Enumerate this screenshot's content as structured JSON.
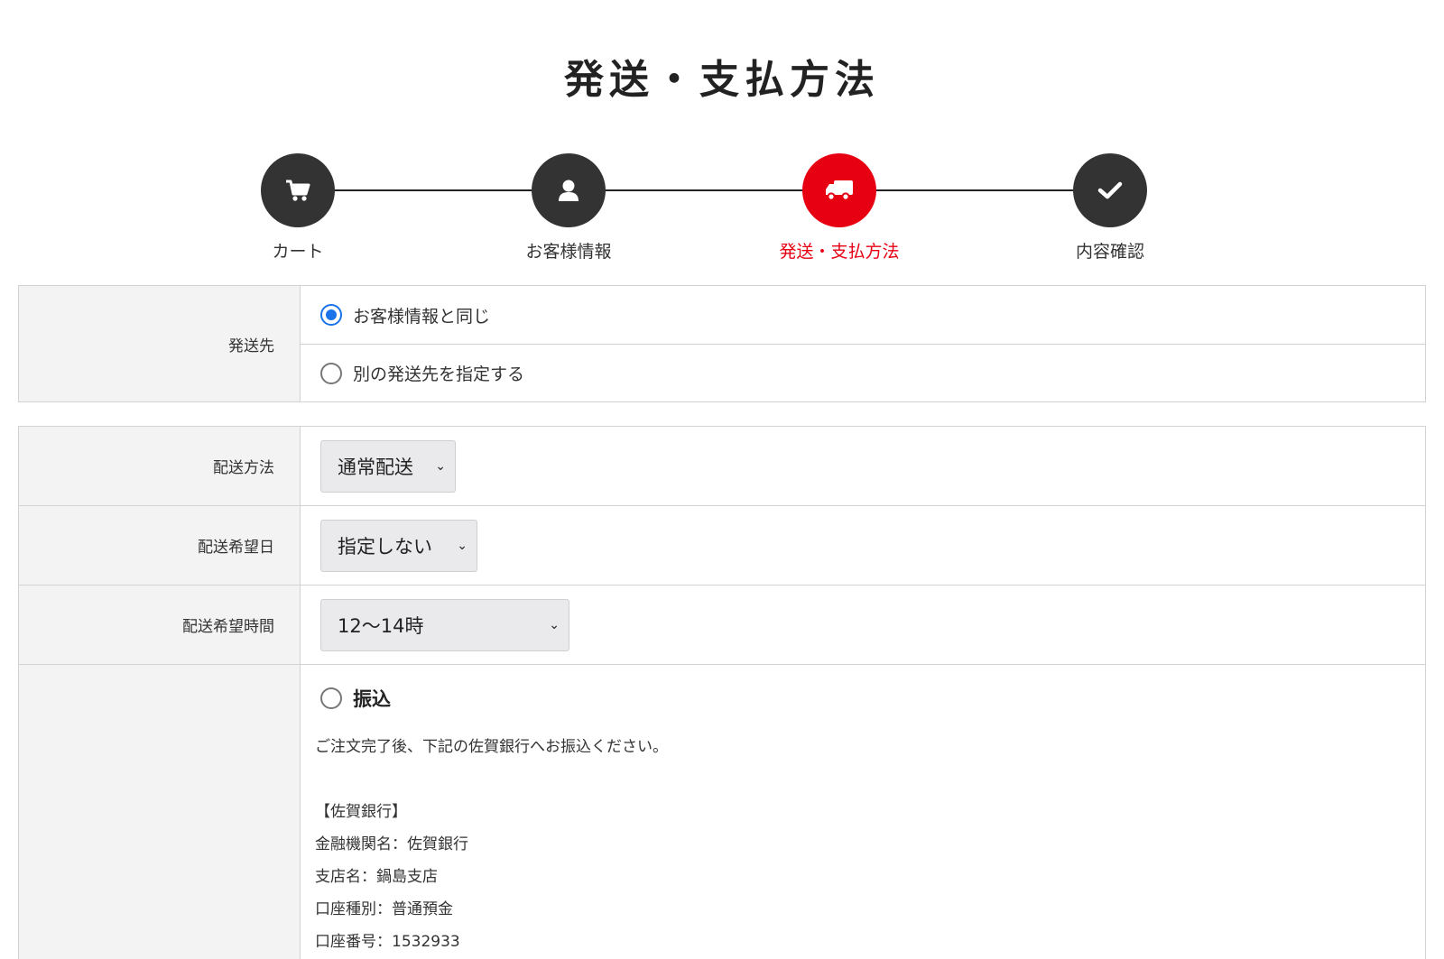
{
  "page": {
    "title": "発送・支払方法"
  },
  "steps": [
    {
      "label": "カート",
      "icon": "cart-icon",
      "active": false
    },
    {
      "label": "お客様情報",
      "icon": "user-icon",
      "active": false
    },
    {
      "label": "発送・支払方法",
      "icon": "truck-icon",
      "active": true
    },
    {
      "label": "内容確認",
      "icon": "check-icon",
      "active": false
    }
  ],
  "colors": {
    "accent": "#e60012",
    "dark": "#333333",
    "radio": "#1a73e8"
  },
  "shipping_destination": {
    "label": "発送先",
    "options": [
      {
        "label": "お客様情報と同じ",
        "checked": true
      },
      {
        "label": "別の発送先を指定する",
        "checked": false
      }
    ]
  },
  "delivery": {
    "method": {
      "label": "配送方法",
      "value": "通常配送"
    },
    "date": {
      "label": "配送希望日",
      "value": "指定しない"
    },
    "time": {
      "label": "配送希望時間",
      "value": "12〜14時"
    }
  },
  "payment": {
    "option_label": "振込",
    "description": "ご注文完了後、下記の佐賀銀行へお振込ください。",
    "bank_lines": [
      "【佐賀銀行】",
      "金融機関名：佐賀銀行",
      "支店名：鍋島支店",
      "口座種別：普通預金",
      "口座番号：1532933"
    ]
  }
}
